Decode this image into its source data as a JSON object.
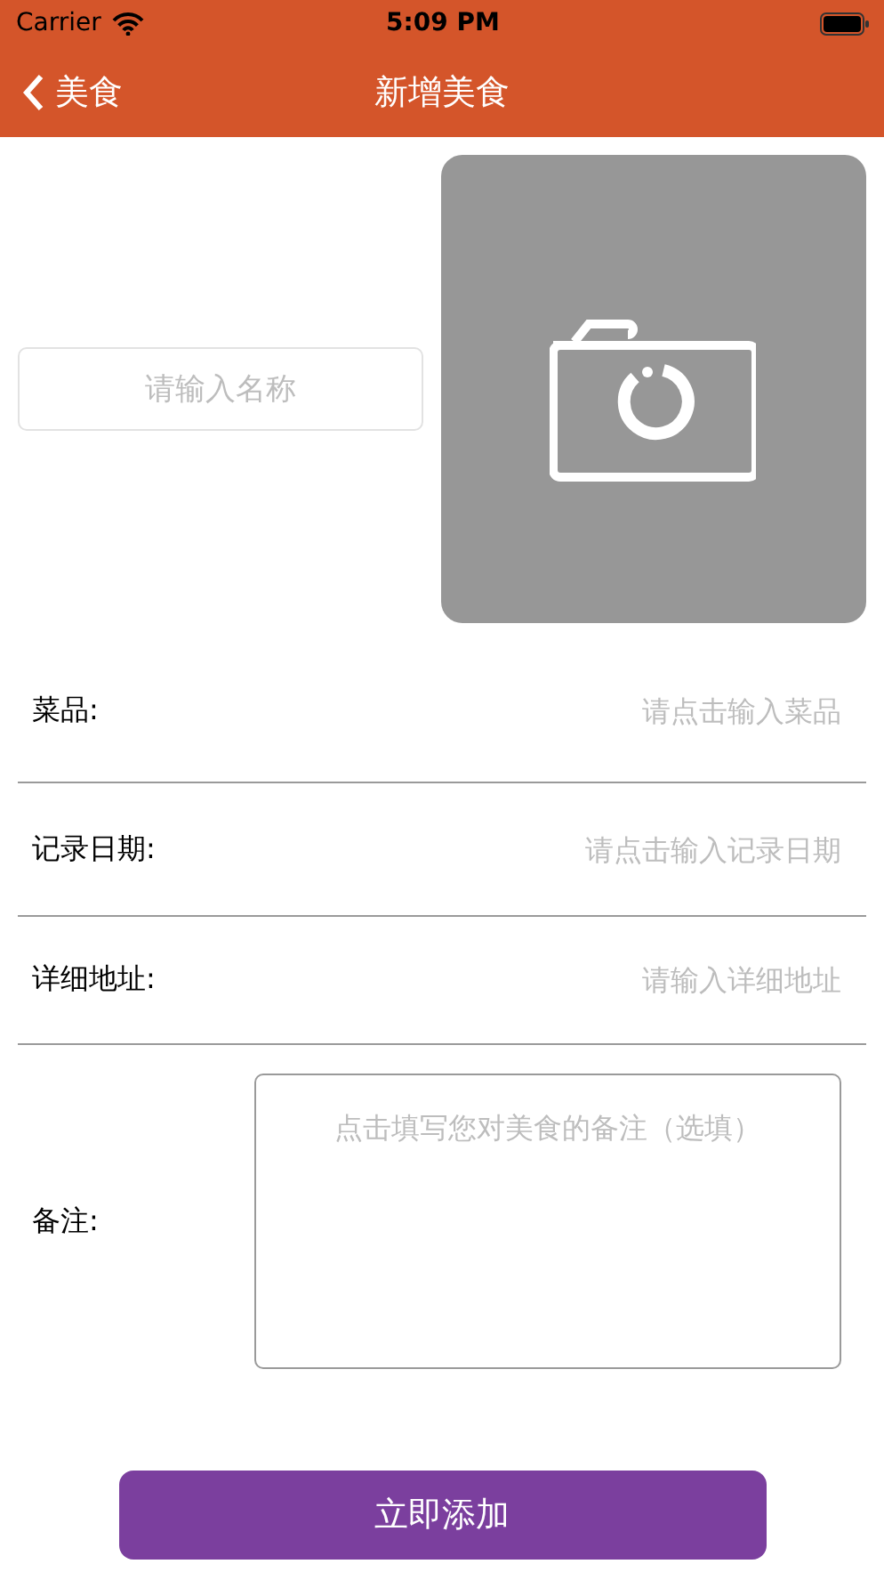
{
  "status_bar": {
    "carrier": "Carrier",
    "time": "5:09 PM"
  },
  "nav": {
    "back": "美食",
    "title": "新增美食"
  },
  "name_field": {
    "placeholder": "请输入名称"
  },
  "photo": {
    "kind": "camera_placeholder"
  },
  "rows": [
    {
      "label": "菜品:",
      "placeholder": "请点击输入菜品"
    },
    {
      "label": "记录日期:",
      "placeholder": "请点击输入记录日期"
    },
    {
      "label": "详细地址:",
      "placeholder": "请输入详细地址"
    }
  ],
  "note": {
    "label": "备注:",
    "placeholder": "点击填写您对美食的备注（选填）"
  },
  "submit": "立即添加"
}
